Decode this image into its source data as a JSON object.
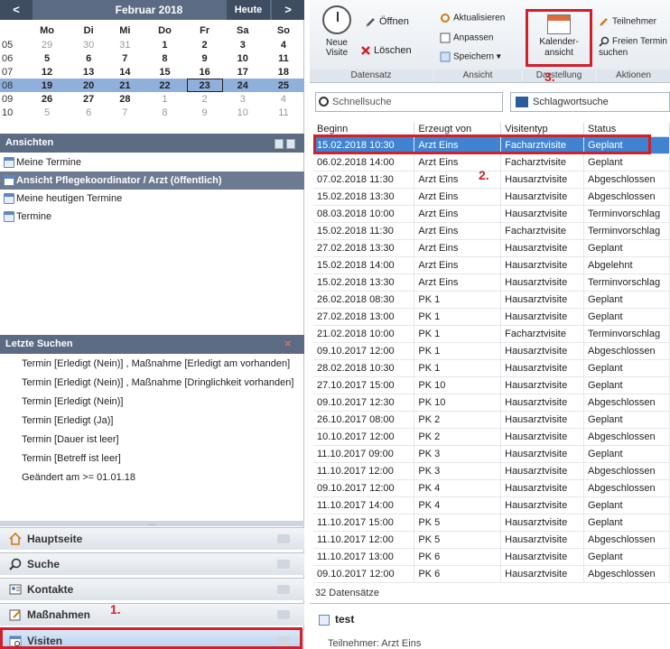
{
  "calendar": {
    "prev": "<",
    "next": ">",
    "month": "Februar 2018",
    "today_label": "Heute",
    "weekdays": [
      "Mo",
      "Di",
      "Mi",
      "Do",
      "Fr",
      "Sa",
      "So"
    ],
    "weeks": [
      {
        "wk": "05",
        "days": [
          "29",
          "30",
          "31",
          "1",
          "2",
          "3",
          "4"
        ]
      },
      {
        "wk": "06",
        "days": [
          "5",
          "6",
          "7",
          "8",
          "9",
          "10",
          "11"
        ]
      },
      {
        "wk": "07",
        "days": [
          "12",
          "13",
          "14",
          "15",
          "16",
          "17",
          "18"
        ]
      },
      {
        "wk": "08",
        "days": [
          "19",
          "20",
          "21",
          "22",
          "23",
          "24",
          "25"
        ]
      },
      {
        "wk": "09",
        "days": [
          "26",
          "27",
          "28",
          "1",
          "2",
          "3",
          "4"
        ]
      },
      {
        "wk": "10",
        "days": [
          "5",
          "6",
          "7",
          "8",
          "9",
          "10",
          "11"
        ]
      }
    ]
  },
  "views": {
    "title": "Ansichten",
    "items": [
      "Meine Termine",
      "Ansicht Pflegekoordinator / Arzt (öffentlich)",
      "Meine heutigen Termine",
      "Termine"
    ]
  },
  "recent": {
    "title": "Letzte Suchen",
    "close": "×",
    "items": [
      "Termin [Erledigt (Nein)] , Maßnahme [Erledigt am vorhanden]",
      "Termin [Erledigt (Nein)] , Maßnahme [Dringlichkeit vorhanden]",
      "Termin [Erledigt (Nein)]",
      "Termin [Erledigt (Ja)]",
      "Termin [Dauer ist leer]",
      "Termin [Betreff ist leer]",
      "Geändert am >= 01.01.18"
    ]
  },
  "nav": {
    "grip": "....",
    "home": "Hauptseite",
    "search": "Suche",
    "contacts": "Kontakte",
    "measures": "Maßnahmen",
    "visits": "Visiten"
  },
  "annotations": {
    "one": "1.",
    "two": "2.",
    "three": "3."
  },
  "ribbon": {
    "new": "Neue Visite",
    "open": "Öffnen",
    "delete": "Löschen",
    "refresh": "Aktualisieren",
    "adjust": "Anpassen",
    "save": "Speichern",
    "calendar": "Kalender-ansicht",
    "participants": "Teilnehmer",
    "free": "Freien Termin suchen",
    "groups": {
      "record": "Datensatz",
      "view": "Ansicht",
      "display": "Darstellung",
      "actions": "Aktionen"
    }
  },
  "search": {
    "quick": "Schnellsuche",
    "keyword": "Schlagwortsuche"
  },
  "grid": {
    "headers": [
      "Beginn",
      "Erzeugt von",
      "Visitentyp",
      "Status"
    ],
    "rows": [
      [
        "15.02.2018 10:30",
        "Arzt Eins",
        "Facharztvisite",
        "Geplant"
      ],
      [
        "06.02.2018 14:00",
        "Arzt Eins",
        "Facharztvisite",
        "Geplant"
      ],
      [
        "07.02.2018 11:30",
        "Arzt Eins",
        "Hausarztvisite",
        "Abgeschlossen"
      ],
      [
        "15.02.2018 13:30",
        "Arzt Eins",
        "Hausarztvisite",
        "Abgeschlossen"
      ],
      [
        "08.03.2018 10:00",
        "Arzt Eins",
        "Hausarztvisite",
        "Terminvorschlag"
      ],
      [
        "15.02.2018 11:30",
        "Arzt Eins",
        "Facharztvisite",
        "Terminvorschlag"
      ],
      [
        "27.02.2018 13:30",
        "Arzt Eins",
        "Hausarztvisite",
        "Geplant"
      ],
      [
        "15.02.2018 14:00",
        "Arzt Eins",
        "Hausarztvisite",
        "Abgelehnt"
      ],
      [
        "15.02.2018 13:30",
        "Arzt Eins",
        "Hausarztvisite",
        "Terminvorschlag"
      ],
      [
        "26.02.2018 08:30",
        "PK 1",
        "Hausarztvisite",
        "Geplant"
      ],
      [
        "27.02.2018 13:00",
        "PK 1",
        "Hausarztvisite",
        "Geplant"
      ],
      [
        "21.02.2018 10:00",
        "PK 1",
        "Facharztvisite",
        "Terminvorschlag"
      ],
      [
        "09.10.2017 12:00",
        "PK 1",
        "Hausarztvisite",
        "Abgeschlossen"
      ],
      [
        "28.02.2018 10:30",
        "PK 1",
        "Hausarztvisite",
        "Geplant"
      ],
      [
        "27.10.2017 15:00",
        "PK 10",
        "Hausarztvisite",
        "Geplant"
      ],
      [
        "09.10.2017 12:30",
        "PK 10",
        "Hausarztvisite",
        "Abgeschlossen"
      ],
      [
        "26.10.2017 08:00",
        "PK 2",
        "Hausarztvisite",
        "Geplant"
      ],
      [
        "10.10.2017 12:00",
        "PK 2",
        "Hausarztvisite",
        "Abgeschlossen"
      ],
      [
        "11.10.2017 09:00",
        "PK 3",
        "Hausarztvisite",
        "Geplant"
      ],
      [
        "11.10.2017 12:00",
        "PK 3",
        "Hausarztvisite",
        "Abgeschlossen"
      ],
      [
        "09.10.2017 12:00",
        "PK 4",
        "Hausarztvisite",
        "Abgeschlossen"
      ],
      [
        "11.10.2017 14:00",
        "PK 4",
        "Hausarztvisite",
        "Geplant"
      ],
      [
        "11.10.2017 15:00",
        "PK 5",
        "Hausarztvisite",
        "Geplant"
      ],
      [
        "11.10.2017 12:00",
        "PK 5",
        "Hausarztvisite",
        "Abgeschlossen"
      ],
      [
        "11.10.2017 13:00",
        "PK 6",
        "Hausarztvisite",
        "Geplant"
      ],
      [
        "09.10.2017 12:00",
        "PK 6",
        "Hausarztvisite",
        "Abgeschlossen"
      ]
    ]
  },
  "count": "32 Datensätze",
  "detail": {
    "title": "test",
    "participants": "Teilnehmer:  Arzt Eins"
  }
}
